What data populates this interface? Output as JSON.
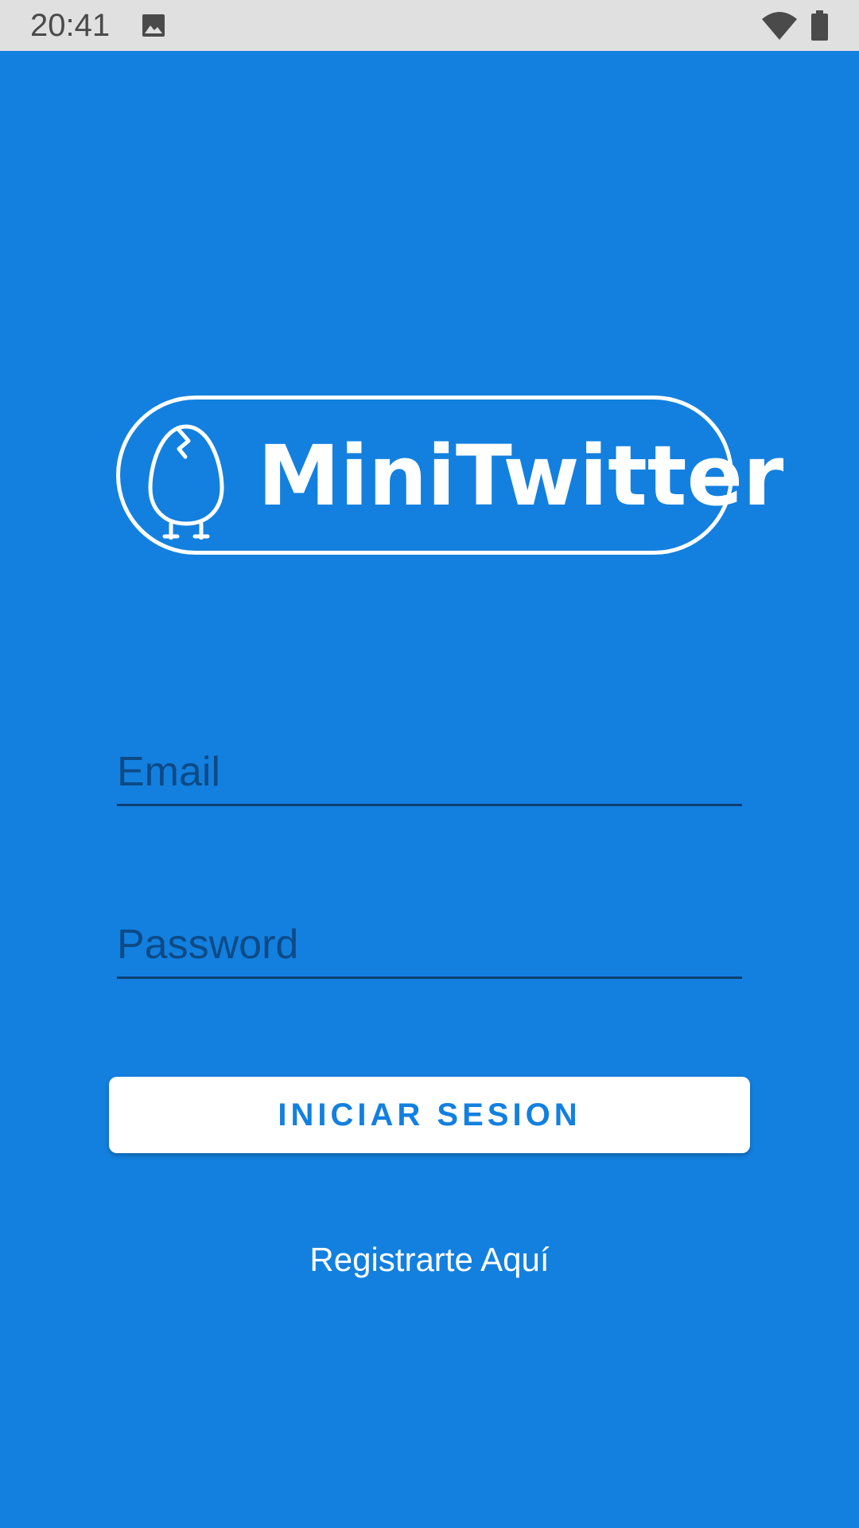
{
  "status_bar": {
    "time": "20:41",
    "icons": [
      "image-icon",
      "wifi-icon",
      "battery-icon"
    ]
  },
  "logo": {
    "icon": "egg-icon",
    "text": "MiniTwitter"
  },
  "form": {
    "email_placeholder": "Email",
    "email_value": "",
    "password_placeholder": "Password",
    "password_value": "",
    "login_label": "INICIAR SESION",
    "register_label": "Registrarte Aquí"
  },
  "colors": {
    "background": "#1380df",
    "status_bar": "#e0e0e0",
    "button_bg": "#ffffff",
    "button_text": "#1380df",
    "field_text": "#0d3f73"
  }
}
